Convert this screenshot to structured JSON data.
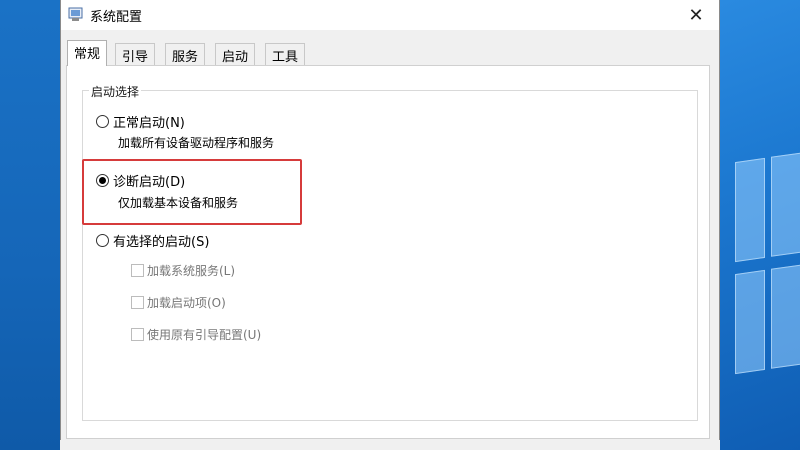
{
  "window": {
    "title": "系统配置",
    "close_glyph": "✕"
  },
  "tabs": [
    {
      "label": "常规",
      "active": true
    },
    {
      "label": "引导",
      "active": false
    },
    {
      "label": "服务",
      "active": false
    },
    {
      "label": "启动",
      "active": false
    },
    {
      "label": "工具",
      "active": false
    }
  ],
  "startup_selection": {
    "group_label": "启动选择",
    "options": [
      {
        "label": "正常启动(N)",
        "description": "加载所有设备驱动程序和服务",
        "selected": false
      },
      {
        "label": "诊断启动(D)",
        "description": "仅加载基本设备和服务",
        "selected": true
      },
      {
        "label": "有选择的启动(S)",
        "selected": false
      }
    ],
    "selective_checkboxes": [
      {
        "label": "加载系统服务(L)",
        "checked": false,
        "enabled": false
      },
      {
        "label": "加载启动项(O)",
        "checked": false,
        "enabled": false
      },
      {
        "label": "使用原有引导配置(U)",
        "checked": false,
        "enabled": false
      }
    ]
  },
  "colors": {
    "highlight_box": "#d63b3b",
    "desktop": "#1b6fc0"
  },
  "icons": {
    "app": "msconfig-icon",
    "close": "close-icon"
  }
}
